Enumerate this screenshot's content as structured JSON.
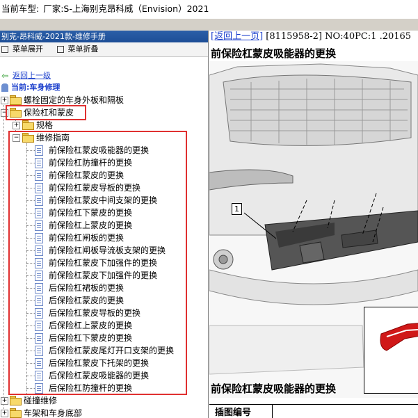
{
  "topbar": {
    "label": "当前车型:",
    "vehicle": "厂家:S-上海别克昂科威（Envision）2021"
  },
  "left_panel": {
    "title": "别克-昂科威-2021款-维修手册",
    "menu": {
      "expand": "菜单展开",
      "collapse": "菜单折叠"
    },
    "back_link": "返回上一级",
    "current": "当前:车身修理",
    "tree": {
      "bolted_panels": "螺栓固定的车身外板和隔板",
      "bumper_fascia": "保险杠和蒙皮",
      "specs": "规格",
      "repair_guide": "维修指南",
      "items": [
        "前保险杠蒙皮吸能器的更换",
        "前保险杠防撞杆的更换",
        "前保险杠蒙皮的更换",
        "前保险杠蒙皮导板的更换",
        "前保险杠蒙皮中间支架的更换",
        "前保险杠下蒙皮的更换",
        "前保险杠上蒙皮的更换",
        "前保险杠闸板的更换",
        "前保险杠闸板导流板支架的更换",
        "前保险杠蒙皮下加强件的更换",
        "前保险杠蒙皮下加强件的更换",
        "后保险杠裙板的更换",
        "后保险杠蒙皮的更换",
        "后保险杠蒙皮导板的更换",
        "后保险杠上蒙皮的更换",
        "后保险杠下蒙皮的更换",
        "后保险杠蒙皮尾灯开口支架的更换",
        "后保险杠蒙皮下托架的更换",
        "后保险杠蒙皮吸能器的更换",
        "后保险杠防撞杆的更换"
      ],
      "collision": "碰撞维修",
      "frame": "车架和车身底部"
    }
  },
  "right_panel": {
    "back_link": "[返回上一页]",
    "doc_info": "[8115958-2] NO:40PC:1 .20165",
    "title": "前保险杠蒙皮吸能器的更换",
    "callout": "1",
    "section_title": "前保险杠蒙皮吸能器的更换",
    "table_header": "插图编号"
  },
  "colors": {
    "highlight_box": "#e03030",
    "link": "#1a3ecc",
    "panel_title_bg": "#1d4e96",
    "inset_part": "#d01818"
  }
}
